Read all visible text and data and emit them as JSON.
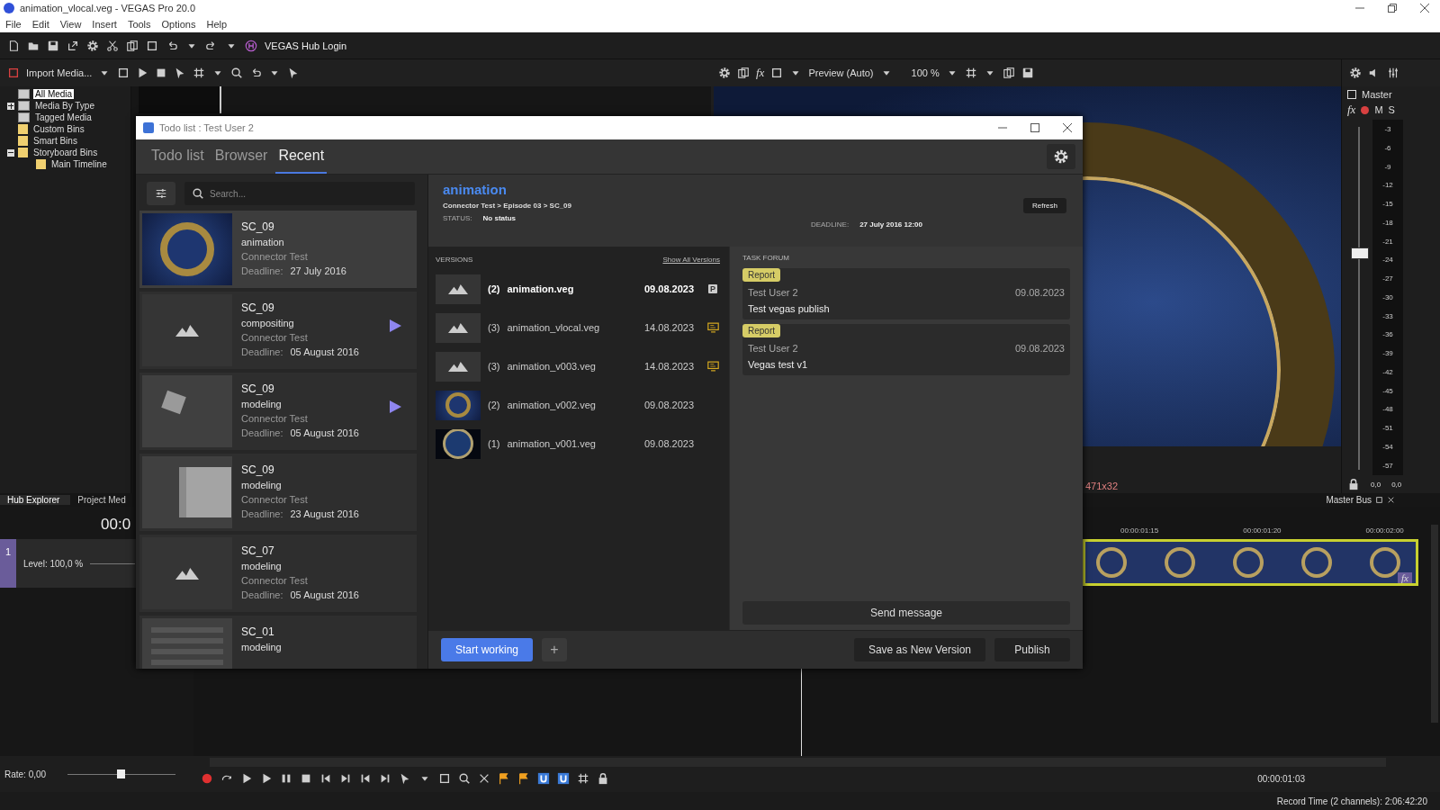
{
  "app": {
    "title": "animation_vlocal.veg - VEGAS Pro 20.0",
    "menu": [
      "File",
      "Edit",
      "View",
      "Insert",
      "Tools",
      "Options",
      "Help"
    ],
    "hub_login": "VEGAS Hub Login"
  },
  "explorer": {
    "import_button": "Import Media...",
    "tree": [
      {
        "label": "All Media",
        "kind": "bin",
        "selected": true
      },
      {
        "label": "Media By Type",
        "kind": "bin",
        "selected": false,
        "expanded": false
      },
      {
        "label": "Tagged Media",
        "kind": "bin",
        "selected": false
      },
      {
        "label": "Custom Bins",
        "kind": "folder",
        "selected": false
      },
      {
        "label": "Smart Bins",
        "kind": "folder",
        "selected": false
      },
      {
        "label": "Storyboard Bins",
        "kind": "folder",
        "selected": false,
        "expanded": true,
        "children": [
          {
            "label": "Main Timeline",
            "kind": "folder",
            "selected": false
          }
        ]
      }
    ],
    "tabs": [
      {
        "label": "Hub Explorer",
        "selected": true
      },
      {
        "label": "Project Med",
        "selected": false
      }
    ]
  },
  "preview": {
    "fx": "fx",
    "mode": "Preview (Auto)",
    "zoom": "100 %",
    "frame_info": "471x32"
  },
  "master": {
    "label": "Master",
    "fx": "fx",
    "buttons": [
      "M",
      "S"
    ],
    "scale": [
      "-3",
      "-6",
      "-9",
      "-12",
      "-15",
      "-18",
      "-21",
      "-24",
      "-27",
      "-30",
      "-33",
      "-36",
      "-39",
      "-42",
      "-45",
      "-48",
      "-51",
      "-54",
      "-57"
    ],
    "level": 0.63,
    "readings": [
      "0,0",
      "0,0"
    ],
    "tab": "Master Bus"
  },
  "track": {
    "number": "1",
    "time": "00:0",
    "level_label": "Level: 100,0 %"
  },
  "timeline": {
    "ruler": [
      "00:00:01:15",
      "00:00:01:20",
      "00:00:02:00"
    ],
    "clip_fx": "fx"
  },
  "transport": {
    "rate": {
      "label": "Rate: 0,00",
      "level": 0.5
    },
    "time": "00:00:01:03"
  },
  "status_bar": {
    "record_time": "Record Time (2 channels): 2:06:42:20"
  },
  "dialog": {
    "title": "Todo list : Test User 2",
    "tabs": [
      {
        "label": "Todo list",
        "selected": false
      },
      {
        "label": "Browser",
        "selected": false
      },
      {
        "label": "Recent",
        "selected": true
      }
    ],
    "search": {
      "placeholder": "Search..."
    },
    "tasks": [
      {
        "shot": "SC_09",
        "task": "animation",
        "project": "Connector Test",
        "deadline_label": "Deadline:",
        "deadline": "27 July 2016",
        "thumb": {
          "kind": "logo"
        },
        "playable": false,
        "selected": true
      },
      {
        "shot": "SC_09",
        "task": "compositing",
        "project": "Connector Test",
        "deadline_label": "Deadline:",
        "deadline": "05 August 2016",
        "thumb": {
          "kind": "placeholder"
        },
        "playable": true,
        "selected": false
      },
      {
        "shot": "SC_09",
        "task": "modeling",
        "project": "Connector Test",
        "deadline_label": "Deadline:",
        "deadline": "05 August 2016",
        "thumb": {
          "kind": "cube"
        },
        "playable": true,
        "selected": false
      },
      {
        "shot": "SC_09",
        "task": "modeling",
        "project": "Connector Test",
        "deadline_label": "Deadline:",
        "deadline": "23 August 2016",
        "thumb": {
          "kind": "box"
        },
        "playable": false,
        "selected": false
      },
      {
        "shot": "SC_07",
        "task": "modeling",
        "project": "Connector Test",
        "deadline_label": "Deadline:",
        "deadline": "05 August 2016",
        "thumb": {
          "kind": "placeholder"
        },
        "playable": false,
        "selected": false
      },
      {
        "shot": "SC_01",
        "task": "modeling",
        "thumb": {
          "kind": "panel"
        },
        "playable": false,
        "selected": false
      }
    ],
    "detail": {
      "task": "animation",
      "path": "Connector Test > Episode 03 > SC_09",
      "status_label": "STATUS:",
      "status": "No status",
      "deadline_label": "DEADLINE:",
      "deadline": "27 July 2016 12:00",
      "refresh": "Refresh"
    },
    "versions": {
      "heading": "VERSIONS",
      "show_all": "Show All Versions",
      "items": [
        {
          "number": "(2)",
          "name": "animation.veg",
          "date": "09.08.2023",
          "thumb": {
            "kind": "placeholder"
          },
          "current": true,
          "badge": {
            "kind": "published",
            "text": "P"
          }
        },
        {
          "number": "(3)",
          "name": "animation_vlocal.veg",
          "date": "14.08.2023",
          "thumb": {
            "kind": "placeholder"
          },
          "current": false,
          "badge": {
            "kind": "local"
          }
        },
        {
          "number": "(3)",
          "name": "animation_v003.veg",
          "date": "14.08.2023",
          "thumb": {
            "kind": "placeholder"
          },
          "current": false,
          "badge": {
            "kind": "local"
          }
        },
        {
          "number": "(2)",
          "name": "animation_v002.veg",
          "date": "09.08.2023",
          "thumb": {
            "kind": "logo"
          },
          "current": false
        },
        {
          "number": "(1)",
          "name": "animation_v001.veg",
          "date": "09.08.2023",
          "thumb": {
            "kind": "ring"
          },
          "current": false
        }
      ]
    },
    "forum": {
      "heading": "TASK FORUM",
      "posts": [
        {
          "tag": "Report",
          "author": "Test User 2",
          "date": "09.08.2023",
          "message": "Test vegas publish"
        },
        {
          "tag": "Report",
          "author": "Test User 2",
          "date": "09.08.2023",
          "message": "Vegas test v1"
        }
      ],
      "send": "Send message"
    },
    "actions": {
      "start": "Start working",
      "add": "+",
      "save_version": "Save as New Version",
      "publish": "Publish"
    }
  }
}
